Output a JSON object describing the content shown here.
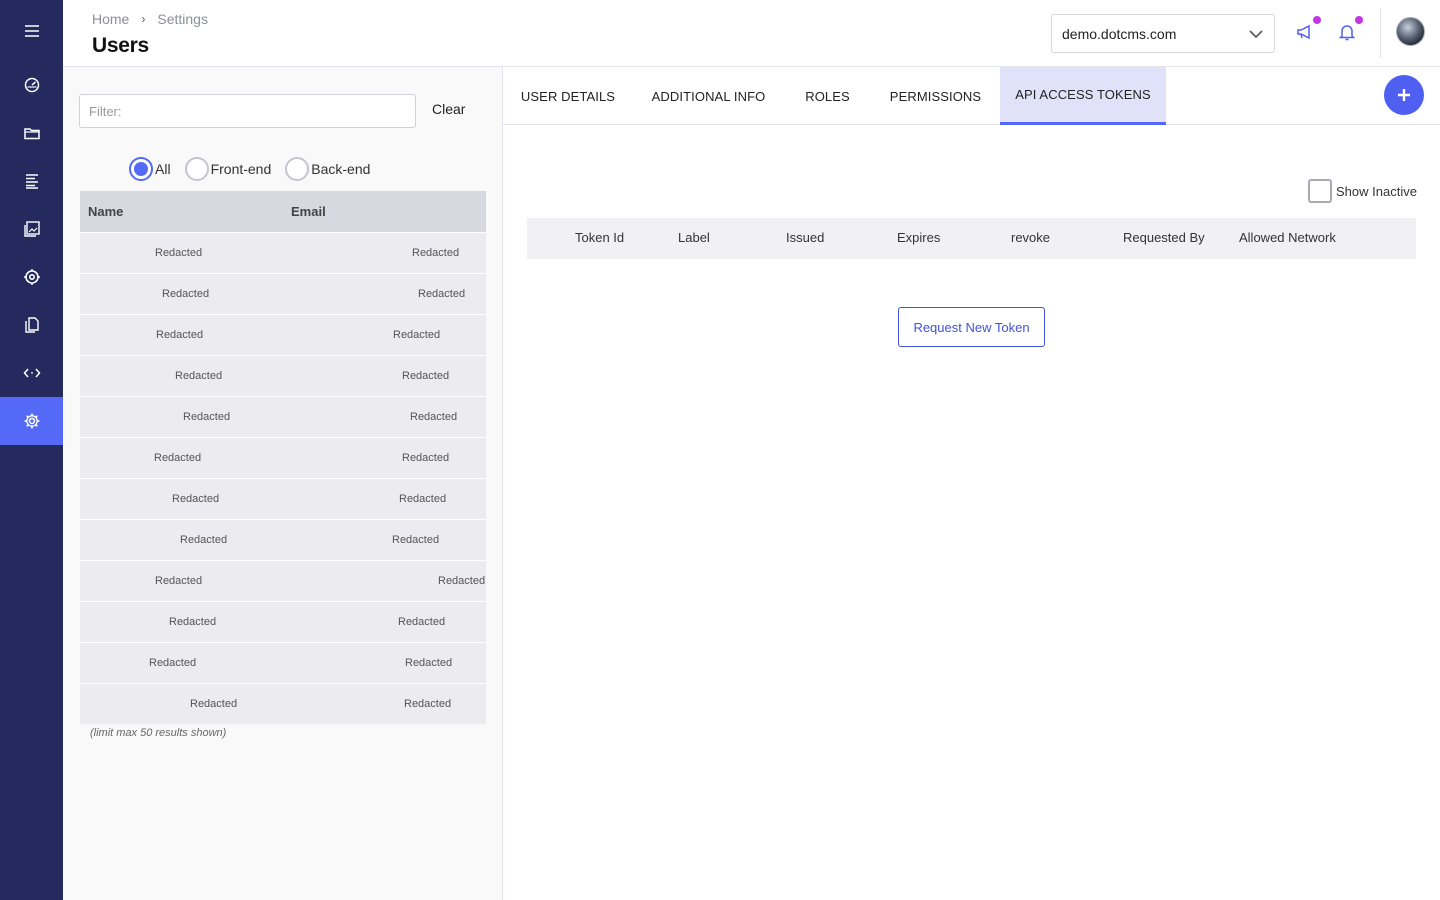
{
  "header": {
    "breadcrumb": [
      "Home",
      "Settings"
    ],
    "breadcrumb_sep": "›",
    "title": "Users",
    "site_selector": "demo.dotcms.com"
  },
  "sidebar": {
    "items": [
      {
        "icon": "menu-icon"
      },
      {
        "icon": "dashboard-icon"
      },
      {
        "icon": "folder-icon"
      },
      {
        "icon": "content-icon"
      },
      {
        "icon": "media-icon"
      },
      {
        "icon": "target-icon"
      },
      {
        "icon": "pages-icon"
      },
      {
        "icon": "code-icon"
      },
      {
        "icon": "settings-icon",
        "active": true
      }
    ]
  },
  "left": {
    "filter_placeholder": "Filter:",
    "clear_label": "Clear",
    "radios": [
      {
        "label": "All",
        "checked": true
      },
      {
        "label": "Front-end",
        "checked": false
      },
      {
        "label": "Back-end",
        "checked": false
      }
    ],
    "table_headers": {
      "name": "Name",
      "email": "Email"
    },
    "rows": [
      {
        "name": "Redacted",
        "email": "Redacted"
      },
      {
        "name": "Redacted",
        "email": "Redacted"
      },
      {
        "name": "Redacted",
        "email": "Redacted"
      },
      {
        "name": "Redacted",
        "email": "Redacted"
      },
      {
        "name": "Redacted",
        "email": "Redacted"
      },
      {
        "name": "Redacted",
        "email": "Redacted"
      },
      {
        "name": "Redacted",
        "email": "Redacted"
      },
      {
        "name": "Redacted",
        "email": "Redacted"
      },
      {
        "name": "Redacted",
        "email": "Redacted"
      },
      {
        "name": "Redacted",
        "email": "Redacted"
      },
      {
        "name": "Redacted",
        "email": "Redacted"
      },
      {
        "name": "Redacted",
        "email": "Redacted"
      }
    ],
    "limit_note": "(limit max 50 results shown)"
  },
  "tabs": [
    {
      "label": "USER DETAILS"
    },
    {
      "label": "ADDITIONAL INFO"
    },
    {
      "label": "ROLES"
    },
    {
      "label": "PERMISSIONS"
    },
    {
      "label": "API ACCESS TOKENS",
      "active": true
    }
  ],
  "tokens": {
    "show_inactive_label": "Show Inactive",
    "columns": [
      "Token Id",
      "Label",
      "Issued",
      "Expires",
      "revoke",
      "Requested By",
      "Allowed Network"
    ],
    "request_button": "Request New Token"
  },
  "colors": {
    "sidebar_bg": "#242a5e",
    "accent": "#5469f5",
    "notification_dot": "#c336e5"
  }
}
